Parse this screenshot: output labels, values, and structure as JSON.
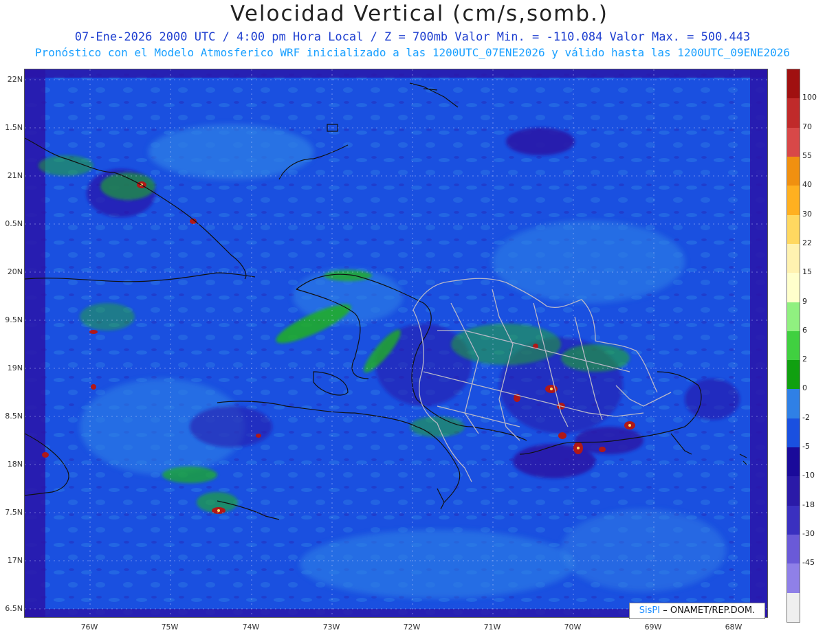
{
  "header": {
    "title": "Velocidad Vertical (cm/s,somb.)",
    "line1": "07-Ene-2026  2000 UTC / 4:00 pm Hora Local / Z = 700mb   Valor Min. = -110.084  Valor Max. = 500.443",
    "line2": "Pronóstico con el Modelo Atmosferico WRF inicializado a las 1200UTC_07ENE2026 y válido hasta las  1200UTC_09ENE2026"
  },
  "map": {
    "lat_labels": [
      "22N",
      "1.5N",
      "21N",
      "0.5N",
      "20N",
      "9.5N",
      "19N",
      "8.5N",
      "18N",
      "7.5N",
      "17N",
      "6.5N"
    ],
    "lon_labels": [
      "76W",
      "75W",
      "74W",
      "73W",
      "72W",
      "71W",
      "70W",
      "69W",
      "68W"
    ],
    "colors": {
      "ocean": "#1a50e0",
      "weak_rise": "#2f80e6",
      "sink": "#2a14a8",
      "strong_sink": "#3a2ab8",
      "green": "#20b020",
      "red": "#b01818",
      "yellow": "#ffe070",
      "border": "#c0c0c0",
      "coast": "#111111"
    }
  },
  "colorbar": {
    "labels": [
      "100",
      "70",
      "55",
      "40",
      "30",
      "22",
      "15",
      "9",
      "6",
      "2",
      "0",
      "-2",
      "-5",
      "-10",
      "-18",
      "-30",
      "-45"
    ],
    "colors": [
      "#a01010",
      "#c02a2a",
      "#d84848",
      "#f09010",
      "#ffb020",
      "#ffd860",
      "#fff2b0",
      "#ffffcc",
      "#90f080",
      "#40d040",
      "#10a010",
      "#2f80e6",
      "#1a50e0",
      "#1a0a9a",
      "#2a1aa8",
      "#3a30c0",
      "#6a5ad8",
      "#8f80e8",
      "#efefef"
    ]
  },
  "credit": {
    "brand": "SisPI",
    "text": "– ONAMET/REP.DOM."
  }
}
